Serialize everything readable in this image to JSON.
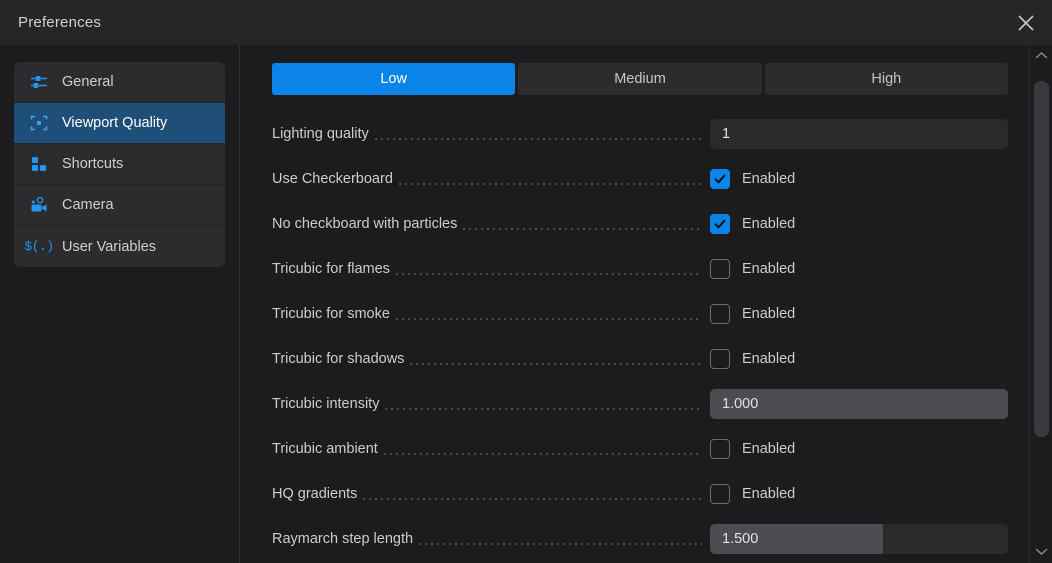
{
  "window": {
    "title": "Preferences",
    "close_icon": "close-icon"
  },
  "accent_color": "#0a84e8",
  "selected_nav_color": "#1f4e79",
  "sidebar": {
    "items": [
      {
        "label": "General",
        "icon": "nodes-sliders-icon",
        "selected": false
      },
      {
        "label": "Viewport Quality",
        "icon": "focus-bracket-icon",
        "selected": true
      },
      {
        "label": "Shortcuts",
        "icon": "grid-squares-icon",
        "selected": false
      },
      {
        "label": "Camera",
        "icon": "video-camera-icon",
        "selected": false
      },
      {
        "label": "User Variables",
        "icon": "dollar-variable-icon",
        "selected": false
      }
    ]
  },
  "content": {
    "quality_tabs": [
      {
        "label": "Low",
        "active": true
      },
      {
        "label": "Medium",
        "active": false
      },
      {
        "label": "High",
        "active": false
      }
    ],
    "settings": [
      {
        "label": "Lighting quality",
        "type": "field",
        "value": "1",
        "fill_pct": 0,
        "highlighted": false
      },
      {
        "label": "Use Checkerboard",
        "type": "checkbox",
        "value": "Enabled",
        "checked": true
      },
      {
        "label": "No checkboard with particles",
        "type": "checkbox",
        "value": "Enabled",
        "checked": true
      },
      {
        "label": "Tricubic for flames",
        "type": "checkbox",
        "value": "Enabled",
        "checked": false
      },
      {
        "label": "Tricubic for smoke",
        "type": "checkbox",
        "value": "Enabled",
        "checked": false
      },
      {
        "label": "Tricubic for shadows",
        "type": "checkbox",
        "value": "Enabled",
        "checked": false
      },
      {
        "label": "Tricubic intensity",
        "type": "field",
        "value": "1.000",
        "fill_pct": 100,
        "highlighted": true
      },
      {
        "label": "Tricubic ambient",
        "type": "checkbox",
        "value": "Enabled",
        "checked": false
      },
      {
        "label": "HQ gradients",
        "type": "checkbox",
        "value": "Enabled",
        "checked": false
      },
      {
        "label": "Raymarch step length",
        "type": "field",
        "value": "1.500",
        "fill_pct": 58,
        "highlighted": false
      }
    ]
  },
  "scrollbar": {
    "up_icon": "chevron-up-icon",
    "down_icon": "chevron-down-icon",
    "thumb_top_pct": 3,
    "thumb_height_pct": 75
  }
}
